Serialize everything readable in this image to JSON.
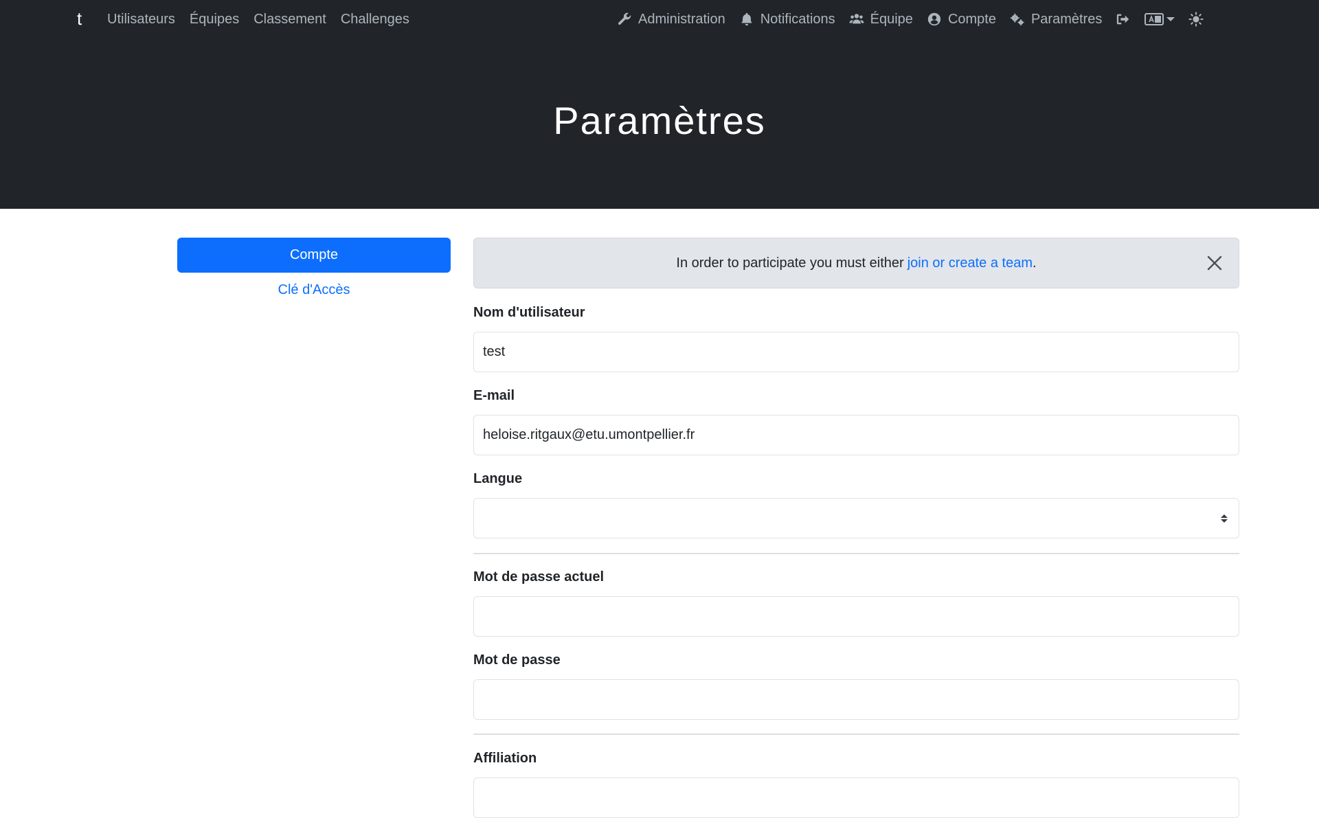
{
  "navbar": {
    "brand": "t",
    "left_links": [
      "Utilisateurs",
      "Équipes",
      "Classement",
      "Challenges"
    ],
    "right_links": [
      {
        "label": "Administration",
        "icon": "wrench-icon"
      },
      {
        "label": "Notifications",
        "icon": "bell-icon"
      },
      {
        "label": "Équipe",
        "icon": "users-icon"
      },
      {
        "label": "Compte",
        "icon": "user-circle-icon"
      },
      {
        "label": "Paramètres",
        "icon": "gears-icon"
      }
    ],
    "icons": [
      "logout-icon",
      "language-icon",
      "theme-toggle-icon"
    ]
  },
  "hero": {
    "title": "Paramètres"
  },
  "sidebar": {
    "active_tab": "Compte",
    "secondary_tab": "Clé d'Accès"
  },
  "alert": {
    "text": "In order to participate you must either",
    "link": "join or create a team",
    "suffix": "."
  },
  "form": {
    "username_label": "Nom d'utilisateur",
    "username_value": "test",
    "email_label": "E-mail",
    "email_value": "heloise.ritgaux@etu.umontpellier.fr",
    "language_label": "Langue",
    "language_value": "",
    "current_password_label": "Mot de passe actuel",
    "password_label": "Mot de passe",
    "affiliation_label": "Affiliation"
  },
  "colors": {
    "primary": "#0d6efd",
    "navbar": "#212529",
    "alert_bg": "#e2e5ea"
  }
}
